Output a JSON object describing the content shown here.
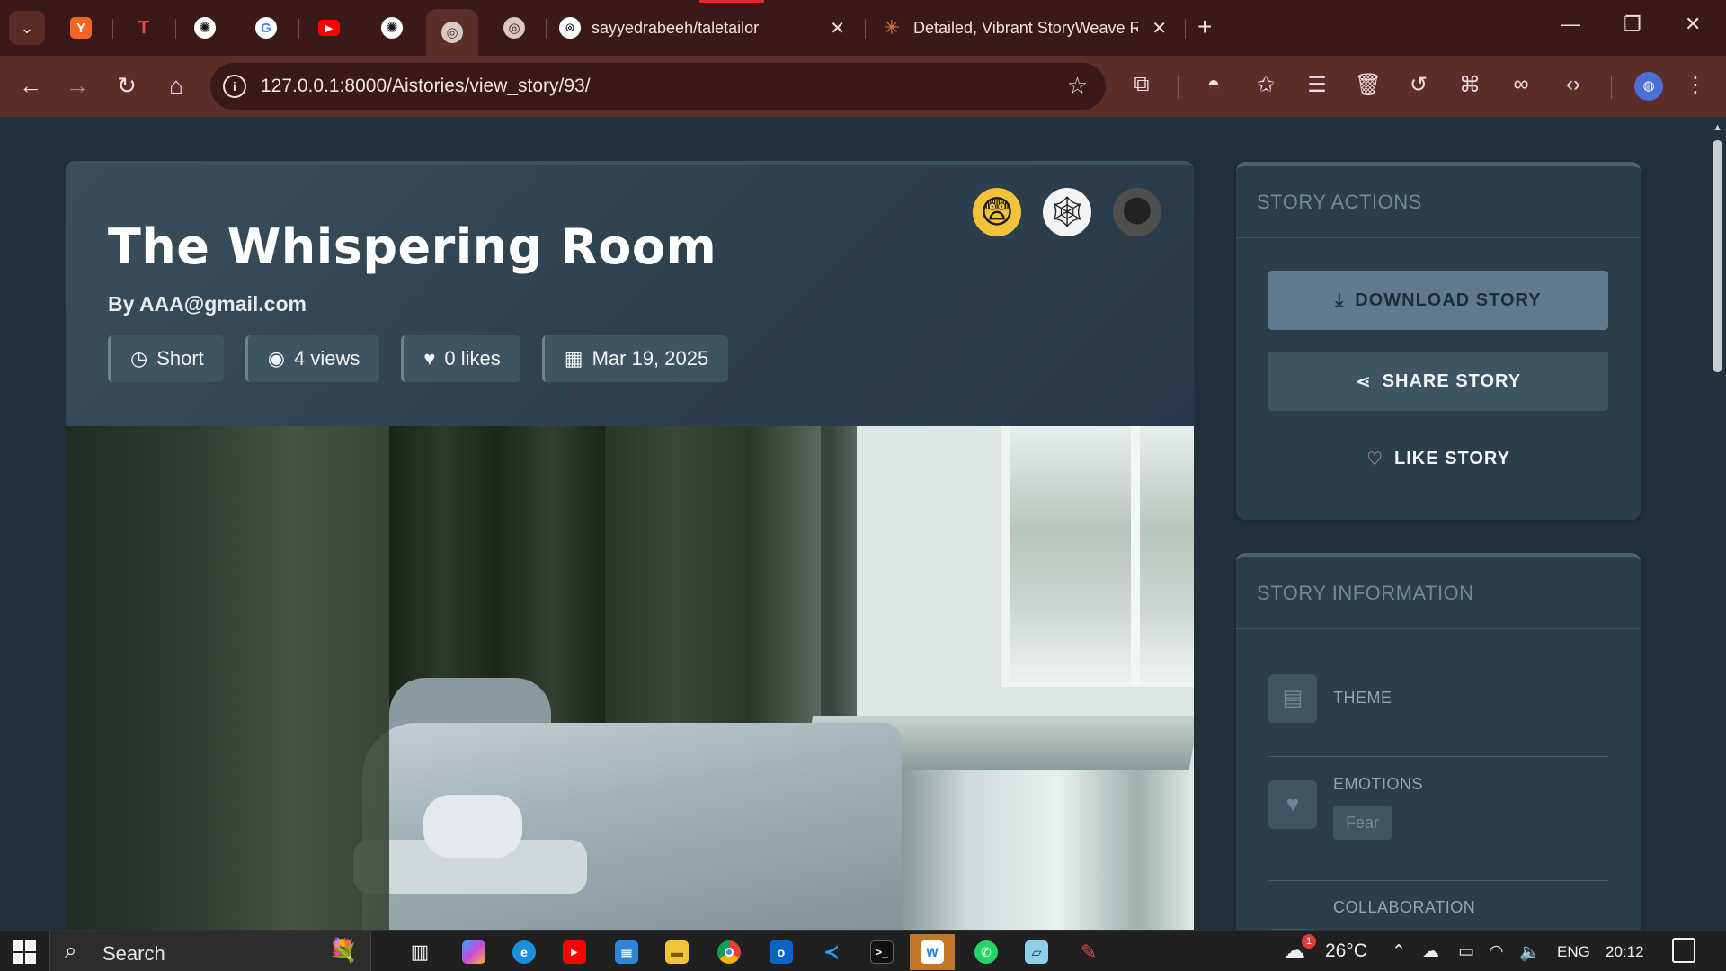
{
  "browser": {
    "pinned_tabs": [
      {
        "name": "y-combinator",
        "glyph": "Y",
        "color": "#f26522"
      },
      {
        "name": "tabler",
        "glyph": "T",
        "color": "#c23a3a"
      },
      {
        "name": "openai",
        "glyph": "✺",
        "color": "#3a1a18"
      },
      {
        "name": "google",
        "glyph": "G",
        "color": "#3a1a18"
      },
      {
        "name": "youtube",
        "glyph": "▶",
        "color": "#ff0000"
      },
      {
        "name": "openai-2",
        "glyph": "✺",
        "color": "#3a1a18"
      },
      {
        "name": "globe-active",
        "glyph": "◎",
        "color": "#5c2e2a"
      },
      {
        "name": "globe",
        "glyph": "◎",
        "color": "#3a1a18"
      }
    ],
    "tabs": [
      {
        "title": "sayyedrabeeh/taletailor",
        "close": "✕"
      },
      {
        "title": "Detailed, Vibrant StoryWeave R",
        "close": "✕"
      }
    ],
    "new_tab": "+",
    "window_controls": {
      "minimize": "—",
      "restore": "❐",
      "close": "✕"
    },
    "url": "127.0.0.1:8000/Aistories/view_story/93/"
  },
  "story": {
    "title": "The Whispering Room",
    "author": "By AAA@gmail.com",
    "badges": [
      {
        "icon": "clock-icon",
        "glyph": "◷",
        "label": "Short"
      },
      {
        "icon": "eye-icon",
        "glyph": "◉",
        "label": "4 views"
      },
      {
        "icon": "heart-icon",
        "glyph": "♥",
        "label": "0 likes"
      },
      {
        "icon": "calendar-icon",
        "glyph": "▦",
        "label": "Mar 19, 2025"
      }
    ],
    "emojis": [
      "😨",
      "🕸",
      "🌑"
    ]
  },
  "actions": {
    "title": "STORY ACTIONS",
    "download": "DOWNLOAD STORY",
    "share": "SHARE STORY",
    "like": "LIKE STORY"
  },
  "info": {
    "title": "STORY INFORMATION",
    "theme_label": "THEME",
    "emotions_label": "EMOTIONS",
    "emotion_tag": "Fear",
    "collaboration_label": "COLLABORATION"
  },
  "taskbar": {
    "search": "Search",
    "weather": "26°C",
    "lang": "ENG",
    "time": "20:12",
    "weather_badge": "1"
  },
  "colors": {
    "page_bg": "#21303c",
    "card_bg": "#2b3b48",
    "accent_button": "#5f7b8d",
    "tab_bar": "#3a1a18",
    "toolbar": "#5c2e2a"
  }
}
